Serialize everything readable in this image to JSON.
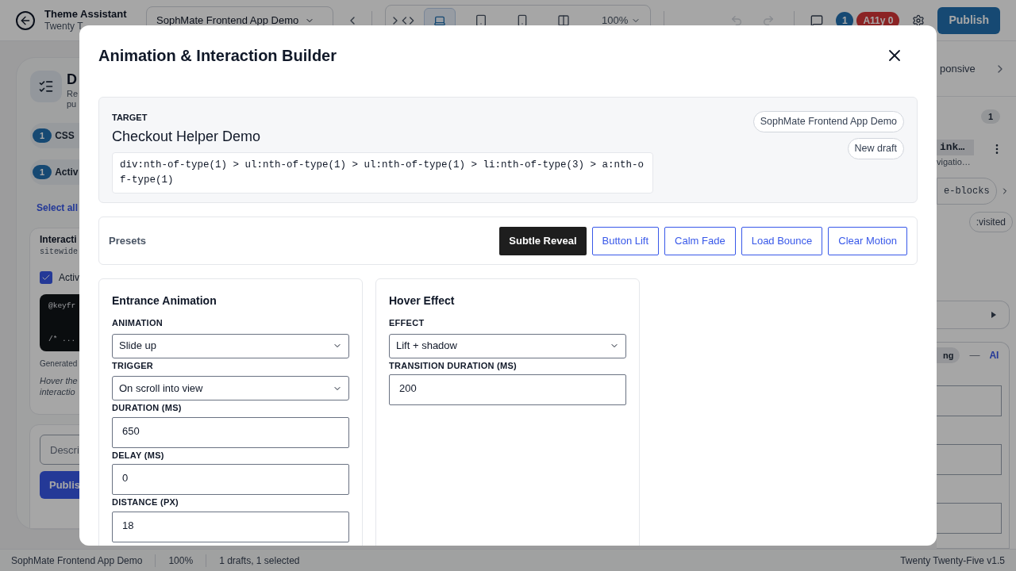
{
  "top_bar": {
    "app_title": "Theme Assistant",
    "site_subtitle": "Twenty T",
    "site_select": "SophMate Frontend App Demo",
    "zoom": "100%",
    "devices": [
      {
        "kind": "desktop",
        "selected": true
      },
      {
        "kind": "tablet",
        "selected": false
      },
      {
        "kind": "mobile",
        "selected": false
      },
      {
        "kind": "split",
        "selected": false
      }
    ],
    "history": [
      {
        "kind": "undo",
        "disabled": true
      },
      {
        "kind": "redo",
        "disabled": true
      }
    ],
    "comment_count": "1",
    "a11y_badge": "A11y 0",
    "publish": "Publish"
  },
  "left_panel": {
    "title": "D",
    "description": [
      "Re",
      "pu"
    ],
    "filters": [
      {
        "count": "1",
        "label": "CSS"
      },
      {
        "count": "1",
        "label": "Activ"
      }
    ],
    "select_all": "Select all",
    "item": {
      "title": "Interacti",
      "scope": "sitewide",
      "active": {
        "label": "Activ",
        "checked": true
      },
      "code": [
        "@keyfr",
        "/* ..."
      ],
      "note": "Generated",
      "hint": [
        "Hover the",
        "interactio"
      ]
    },
    "composer": {
      "placeholder": "Descri",
      "button": "Publis"
    }
  },
  "right_panel": {
    "tab": "ponsive",
    "count": "1",
    "item_title": "ink…",
    "item_subtitle": "vigatio…",
    "chip": "e-blocks",
    "state_chip": ":visited",
    "source": {
      "chip": "ng",
      "separator": "—",
      "link": "AI"
    }
  },
  "dialog": {
    "title": "Animation & Interaction Builder",
    "target": {
      "label": "TARGET",
      "name": "Checkout Helper Demo",
      "selector": "div:nth-of-type(1) > ul:nth-of-type(1) > ul:nth-of-type(1) > li:nth-of-type(3) > a:nth-of-type(1)",
      "site": "SophMate Frontend App Demo",
      "status": "New draft"
    },
    "presets": {
      "label": "Presets",
      "items": [
        {
          "label": "Subtle Reveal",
          "selected": true
        },
        {
          "label": "Button Lift",
          "selected": false
        },
        {
          "label": "Calm Fade",
          "selected": false
        },
        {
          "label": "Load Bounce",
          "selected": false
        },
        {
          "label": "Clear Motion",
          "selected": false
        }
      ]
    },
    "panels": [
      {
        "title": "Entrance Animation",
        "fields": [
          {
            "kind": "select",
            "label": "ANIMATION",
            "value": "Slide up"
          },
          {
            "kind": "select",
            "label": "TRIGGER",
            "value": "On scroll into view"
          },
          {
            "kind": "number",
            "label": "DURATION (MS)",
            "value": "650"
          },
          {
            "kind": "number",
            "label": "DELAY (MS)",
            "value": "0"
          },
          {
            "kind": "number",
            "label": "DISTANCE (PX)",
            "value": "18"
          }
        ]
      },
      {
        "title": "Hover Effect",
        "fields": [
          {
            "kind": "select",
            "label": "EFFECT",
            "value": "Lift + shadow"
          },
          {
            "kind": "number",
            "label": "TRANSITION DURATION (MS)",
            "value": "200"
          }
        ]
      }
    ]
  },
  "status_bar": {
    "site": "SophMate Frontend App Demo",
    "zoom": "100%",
    "drafts": "1 drafts, 1 selected",
    "theme": "Twenty Twenty-Five v1.5"
  }
}
